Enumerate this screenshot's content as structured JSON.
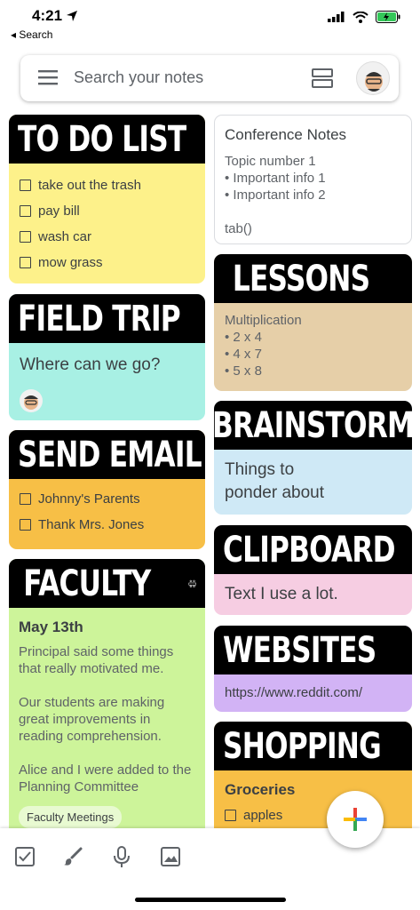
{
  "status": {
    "time": "4:21",
    "back_label": "◂ Search"
  },
  "search": {
    "placeholder": "Search your notes"
  },
  "notes": {
    "todo": {
      "title": "TO DO LIST",
      "items": [
        "take out the trash",
        "pay bill",
        "wash car",
        "mow grass"
      ],
      "color": "#fdf18a"
    },
    "conference": {
      "title": "Conference Notes",
      "lines": [
        "Topic number 1",
        "• Important info 1",
        "• Important info 2",
        "",
        "tab()"
      ]
    },
    "lessons": {
      "title": "LESSONS",
      "subtitle": "Multiplication",
      "lines": [
        "• 2 x 4",
        "• 4 x 7",
        "• 5 x 8"
      ],
      "color": "#e6cfa8"
    },
    "field_trip": {
      "title": "FIELD TRIP",
      "text": "Where can we go?",
      "color": "#a8f0e4"
    },
    "brainstorm": {
      "title": "BRAINSTORM",
      "lines": [
        "Things to",
        "ponder about"
      ],
      "color": "#cfe9f6"
    },
    "send_email": {
      "title": "SEND EMAIL",
      "items": [
        "Johnny's Parents",
        "Thank Mrs. Jones"
      ],
      "color": "#f7bf46"
    },
    "clipboard": {
      "title": "CLIPBOARD",
      "text": "Text I use a lot.",
      "color": "#f6cde2"
    },
    "faculty": {
      "title": "FACULTY",
      "heading": "May 13th",
      "paragraphs": [
        "Principal said some things that really motivated me.",
        "Our students are making great improvements in reading comprehension.",
        "Alice and I were added to the Planning Committee"
      ],
      "chip": "Faculty Meetings",
      "color": "#cdf49a"
    },
    "websites": {
      "title": "WEBSITES",
      "url": "https://www.reddit.com/",
      "color": "#d2b3f5"
    },
    "shopping": {
      "title": "SHOPPING",
      "heading": "Groceries",
      "items": [
        "apples"
      ],
      "color": "#f7bf46"
    }
  },
  "icons": {
    "checkbox": "checkbox-icon",
    "brush": "brush-icon",
    "mic": "mic-icon",
    "image": "image-icon",
    "plus": "plus-icon"
  }
}
